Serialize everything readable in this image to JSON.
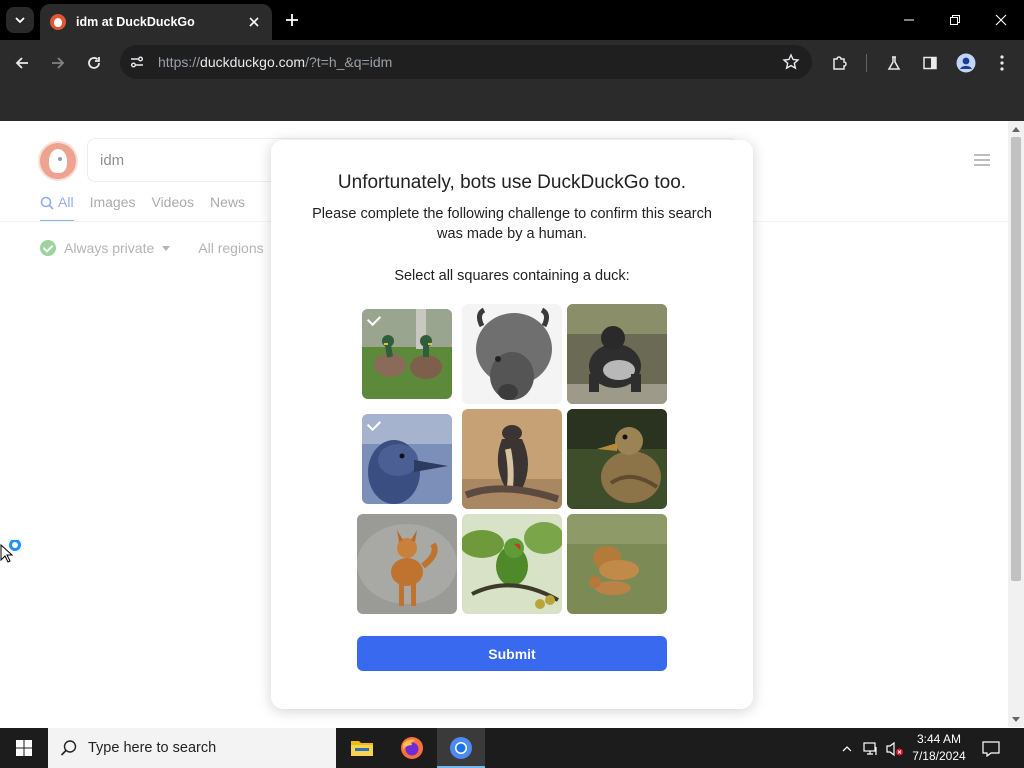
{
  "browser": {
    "tab_title": "idm at DuckDuckGo",
    "url_prefix": "https://",
    "url_host": "duckduckgo.com",
    "url_path": "/?t=h_&q=idm"
  },
  "ddg": {
    "query": "idm",
    "tabs": [
      "All",
      "Images",
      "Videos",
      "News"
    ],
    "filters": {
      "privacy": "Always private",
      "region": "All regions"
    }
  },
  "challenge": {
    "title": "Unfortunately, bots use DuckDuckGo too.",
    "subtitle": "Please complete the following challenge to confirm this search was made by a human.",
    "prompt": "Select all squares containing a duck:",
    "tiles": [
      {
        "subject": "two mallard ducks",
        "selected": true
      },
      {
        "subject": "bison",
        "selected": false
      },
      {
        "subject": "gorilla",
        "selected": false
      },
      {
        "subject": "duck head",
        "selected": true
      },
      {
        "subject": "cobra",
        "selected": false
      },
      {
        "subject": "duck",
        "selected": false
      },
      {
        "subject": "dog",
        "selected": false
      },
      {
        "subject": "parrot",
        "selected": false
      },
      {
        "subject": "lion",
        "selected": false
      }
    ],
    "submit_label": "Submit"
  },
  "taskbar": {
    "search_placeholder": "Type here to search",
    "time": "3:44 AM",
    "date": "7/18/2024"
  },
  "colors": {
    "accent": "#3969ef",
    "ddg_orange": "#de5833",
    "private_green": "#4caf50"
  }
}
